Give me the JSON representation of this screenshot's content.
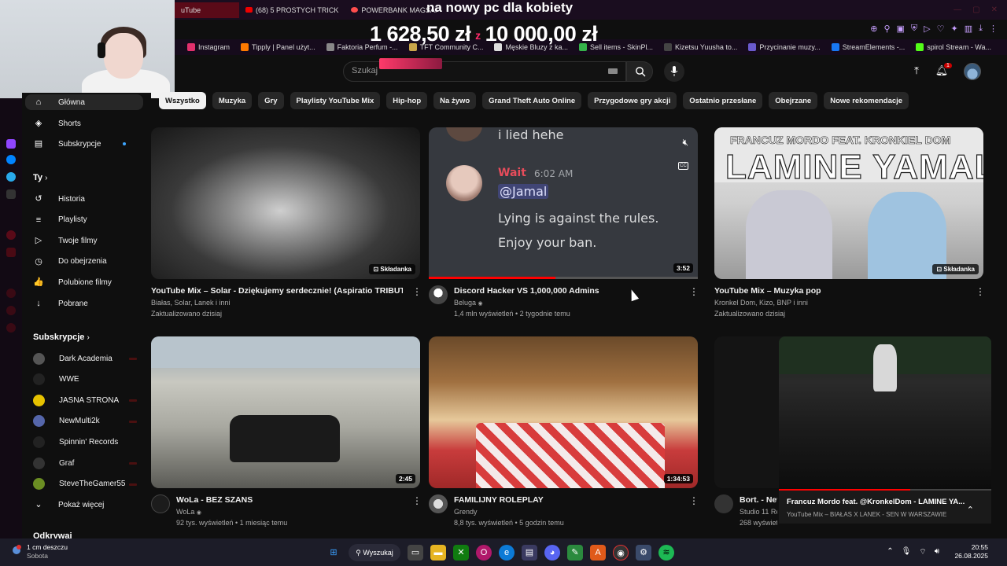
{
  "browser": {
    "tabs": [
      {
        "label": "uTube",
        "active": true
      },
      {
        "label": "(68) 5 PROSTYCH TRICK"
      },
      {
        "label": "POWERBANK MAGSAF"
      }
    ],
    "bookmarks": [
      {
        "label": "Instagram",
        "color": "#e1306c"
      },
      {
        "label": "Tipply | Panel użyt...",
        "color": "#ff7a00"
      },
      {
        "label": "Faktoria Perfum -...",
        "color": "#888888"
      },
      {
        "label": "TFT Community C...",
        "color": "#c9a64a"
      },
      {
        "label": "Męskie Bluzy z ka...",
        "color": "#dddddd"
      },
      {
        "label": "Sell items - SkinPl...",
        "color": "#35b24a"
      },
      {
        "label": "Kizetsu Yuusha to...",
        "color": "#444444"
      },
      {
        "label": "Przycinanie muzy...",
        "color": "#6a5acd"
      },
      {
        "label": "StreamElements -...",
        "color": "#1877f2"
      },
      {
        "label": "spirol Stream - Wa...",
        "color": "#53fc18"
      }
    ]
  },
  "overlay": {
    "headline": "na nowy pc dla kobiety",
    "raised": "1 628,50 zł",
    "separator": "z",
    "goal": "10 000,00 zł"
  },
  "header": {
    "search_placeholder": "Szukaj",
    "notifications_count": "1"
  },
  "sidebar": {
    "main": [
      {
        "label": "Główna",
        "icon": "home-icon",
        "glyph": "⌂",
        "active": true
      },
      {
        "label": "Shorts",
        "icon": "shorts-icon",
        "glyph": "◈"
      },
      {
        "label": "Subskrypcje",
        "icon": "subscriptions-icon",
        "glyph": "▤"
      }
    ],
    "you_heading": "Ty",
    "you": [
      {
        "label": "Historia",
        "icon": "history-icon",
        "glyph": "↺"
      },
      {
        "label": "Playlisty",
        "icon": "playlists-icon",
        "glyph": "≡"
      },
      {
        "label": "Twoje filmy",
        "icon": "your-videos-icon",
        "glyph": "▷"
      },
      {
        "label": "Do obejrzenia",
        "icon": "watch-later-icon",
        "glyph": "◷"
      },
      {
        "label": "Polubione filmy",
        "icon": "liked-icon",
        "glyph": "👍"
      },
      {
        "label": "Pobrane",
        "icon": "downloads-icon",
        "glyph": "↓"
      }
    ],
    "subs_heading": "Subskrypcje",
    "subs": [
      {
        "label": "Dark Academia",
        "color": "#555555",
        "live": true
      },
      {
        "label": "WWE",
        "color": "#222222",
        "live": false
      },
      {
        "label": "JASNA STRONA",
        "color": "#e6c200",
        "live": true
      },
      {
        "label": "NewMulti2k",
        "color": "#5566aa",
        "live": true
      },
      {
        "label": "Spinnin' Records",
        "color": "#222222",
        "live": false
      },
      {
        "label": "Graf",
        "color": "#333333",
        "live": true
      },
      {
        "label": "SteveTheGamer55",
        "color": "#6b8e23",
        "live": true
      }
    ],
    "show_more": "Pokaż więcej",
    "explore_heading": "Odkrywaj"
  },
  "chips": [
    "Wszystko",
    "Muzyka",
    "Gry",
    "Playlisty YouTube Mix",
    "Hip-hop",
    "Na żywo",
    "Grand Theft Auto Online",
    "Przygodowe gry akcji",
    "Ostatnio przesłane",
    "Obejrzane",
    "Nowe rekomendacje"
  ],
  "videos": [
    {
      "title": "YouTube Mix – Solar - Dziękujemy serdecznie! (Aspiratio TRIBUTE)",
      "meta1": "Białas, Solar, Lanek i inni",
      "meta2": "Zaktualizowano dzisiaj",
      "badge": "Składanka"
    },
    {
      "title": "Discord Hacker VS 1,000,000 Admins",
      "channel": "Beluga",
      "meta2": "1,4 mln wyświetleń • 2 tygodnie temu",
      "duration": "3:52",
      "progress": 0.47
    },
    {
      "title": "YouTube Mix – Muzyka pop",
      "meta1": "Kronkel Dom, Kizo, BNP i inni",
      "meta2": "Zaktualizowano dzisiaj",
      "badge": "Składanka",
      "thumb_text": "FRANCUZ MORDO FEAT. KRONKIEL DOM",
      "thumb_big": "LAMINE YAMAL"
    },
    {
      "title": "WoLa - BEZ SZANS",
      "channel": "WoLa",
      "meta2": "92 tys. wyświetleń • 1 miesiąc temu",
      "duration": "2:45"
    },
    {
      "title": "FAMILIJNY ROLEPLAY",
      "channel": "Grendy",
      "meta2": "8,8 tys. wyświetleń • 5 godzin temu",
      "duration": "1:34:53"
    },
    {
      "title": "Bort. - Nev",
      "channel": "Studio 11 Re",
      "meta2": "268 wyświetl"
    }
  ],
  "discord_thumb": {
    "line_top": "i lied hehe",
    "username": "Wait",
    "time": "6:02 AM",
    "mention": "@Jamal",
    "line1": "Lying is against the rules.",
    "line2": "Enjoy your ban."
  },
  "miniplayer": {
    "title": "Francuz Mordo feat. @KronkelDom - LAMINE YA...",
    "subtitle": "YouTube Mix – BIAŁAS X LANEK - SEN W WARSZAWIE",
    "progress": 0.62
  },
  "taskbar": {
    "weather_line1": "1 cm deszczu",
    "weather_line2": "Sobota",
    "search_label": "Wyszukaj",
    "time": "20:55",
    "date": "26.08.2025"
  }
}
